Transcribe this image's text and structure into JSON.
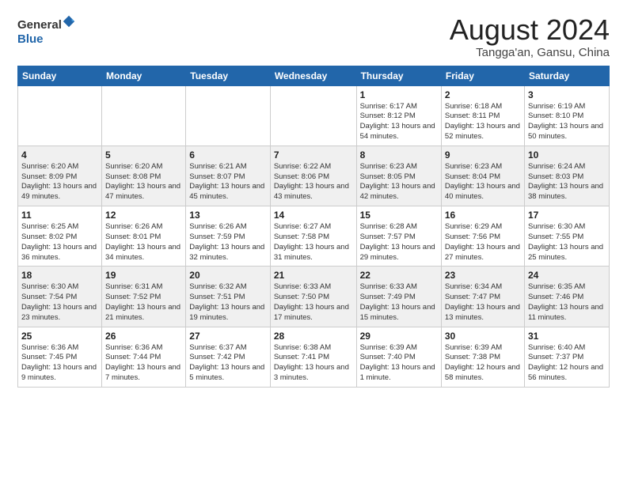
{
  "header": {
    "logo_general": "General",
    "logo_blue": "Blue",
    "month_title": "August 2024",
    "location": "Tangga'an, Gansu, China"
  },
  "days_of_week": [
    "Sunday",
    "Monday",
    "Tuesday",
    "Wednesday",
    "Thursday",
    "Friday",
    "Saturday"
  ],
  "weeks": [
    [
      {
        "day": "",
        "info": ""
      },
      {
        "day": "",
        "info": ""
      },
      {
        "day": "",
        "info": ""
      },
      {
        "day": "",
        "info": ""
      },
      {
        "day": "1",
        "info": "Sunrise: 6:17 AM\nSunset: 8:12 PM\nDaylight: 13 hours\nand 54 minutes."
      },
      {
        "day": "2",
        "info": "Sunrise: 6:18 AM\nSunset: 8:11 PM\nDaylight: 13 hours\nand 52 minutes."
      },
      {
        "day": "3",
        "info": "Sunrise: 6:19 AM\nSunset: 8:10 PM\nDaylight: 13 hours\nand 50 minutes."
      }
    ],
    [
      {
        "day": "4",
        "info": "Sunrise: 6:20 AM\nSunset: 8:09 PM\nDaylight: 13 hours\nand 49 minutes."
      },
      {
        "day": "5",
        "info": "Sunrise: 6:20 AM\nSunset: 8:08 PM\nDaylight: 13 hours\nand 47 minutes."
      },
      {
        "day": "6",
        "info": "Sunrise: 6:21 AM\nSunset: 8:07 PM\nDaylight: 13 hours\nand 45 minutes."
      },
      {
        "day": "7",
        "info": "Sunrise: 6:22 AM\nSunset: 8:06 PM\nDaylight: 13 hours\nand 43 minutes."
      },
      {
        "day": "8",
        "info": "Sunrise: 6:23 AM\nSunset: 8:05 PM\nDaylight: 13 hours\nand 42 minutes."
      },
      {
        "day": "9",
        "info": "Sunrise: 6:23 AM\nSunset: 8:04 PM\nDaylight: 13 hours\nand 40 minutes."
      },
      {
        "day": "10",
        "info": "Sunrise: 6:24 AM\nSunset: 8:03 PM\nDaylight: 13 hours\nand 38 minutes."
      }
    ],
    [
      {
        "day": "11",
        "info": "Sunrise: 6:25 AM\nSunset: 8:02 PM\nDaylight: 13 hours\nand 36 minutes."
      },
      {
        "day": "12",
        "info": "Sunrise: 6:26 AM\nSunset: 8:01 PM\nDaylight: 13 hours\nand 34 minutes."
      },
      {
        "day": "13",
        "info": "Sunrise: 6:26 AM\nSunset: 7:59 PM\nDaylight: 13 hours\nand 32 minutes."
      },
      {
        "day": "14",
        "info": "Sunrise: 6:27 AM\nSunset: 7:58 PM\nDaylight: 13 hours\nand 31 minutes."
      },
      {
        "day": "15",
        "info": "Sunrise: 6:28 AM\nSunset: 7:57 PM\nDaylight: 13 hours\nand 29 minutes."
      },
      {
        "day": "16",
        "info": "Sunrise: 6:29 AM\nSunset: 7:56 PM\nDaylight: 13 hours\nand 27 minutes."
      },
      {
        "day": "17",
        "info": "Sunrise: 6:30 AM\nSunset: 7:55 PM\nDaylight: 13 hours\nand 25 minutes."
      }
    ],
    [
      {
        "day": "18",
        "info": "Sunrise: 6:30 AM\nSunset: 7:54 PM\nDaylight: 13 hours\nand 23 minutes."
      },
      {
        "day": "19",
        "info": "Sunrise: 6:31 AM\nSunset: 7:52 PM\nDaylight: 13 hours\nand 21 minutes."
      },
      {
        "day": "20",
        "info": "Sunrise: 6:32 AM\nSunset: 7:51 PM\nDaylight: 13 hours\nand 19 minutes."
      },
      {
        "day": "21",
        "info": "Sunrise: 6:33 AM\nSunset: 7:50 PM\nDaylight: 13 hours\nand 17 minutes."
      },
      {
        "day": "22",
        "info": "Sunrise: 6:33 AM\nSunset: 7:49 PM\nDaylight: 13 hours\nand 15 minutes."
      },
      {
        "day": "23",
        "info": "Sunrise: 6:34 AM\nSunset: 7:47 PM\nDaylight: 13 hours\nand 13 minutes."
      },
      {
        "day": "24",
        "info": "Sunrise: 6:35 AM\nSunset: 7:46 PM\nDaylight: 13 hours\nand 11 minutes."
      }
    ],
    [
      {
        "day": "25",
        "info": "Sunrise: 6:36 AM\nSunset: 7:45 PM\nDaylight: 13 hours\nand 9 minutes."
      },
      {
        "day": "26",
        "info": "Sunrise: 6:36 AM\nSunset: 7:44 PM\nDaylight: 13 hours\nand 7 minutes."
      },
      {
        "day": "27",
        "info": "Sunrise: 6:37 AM\nSunset: 7:42 PM\nDaylight: 13 hours\nand 5 minutes."
      },
      {
        "day": "28",
        "info": "Sunrise: 6:38 AM\nSunset: 7:41 PM\nDaylight: 13 hours\nand 3 minutes."
      },
      {
        "day": "29",
        "info": "Sunrise: 6:39 AM\nSunset: 7:40 PM\nDaylight: 13 hours\nand 1 minute."
      },
      {
        "day": "30",
        "info": "Sunrise: 6:39 AM\nSunset: 7:38 PM\nDaylight: 12 hours\nand 58 minutes."
      },
      {
        "day": "31",
        "info": "Sunrise: 6:40 AM\nSunset: 7:37 PM\nDaylight: 12 hours\nand 56 minutes."
      }
    ]
  ]
}
